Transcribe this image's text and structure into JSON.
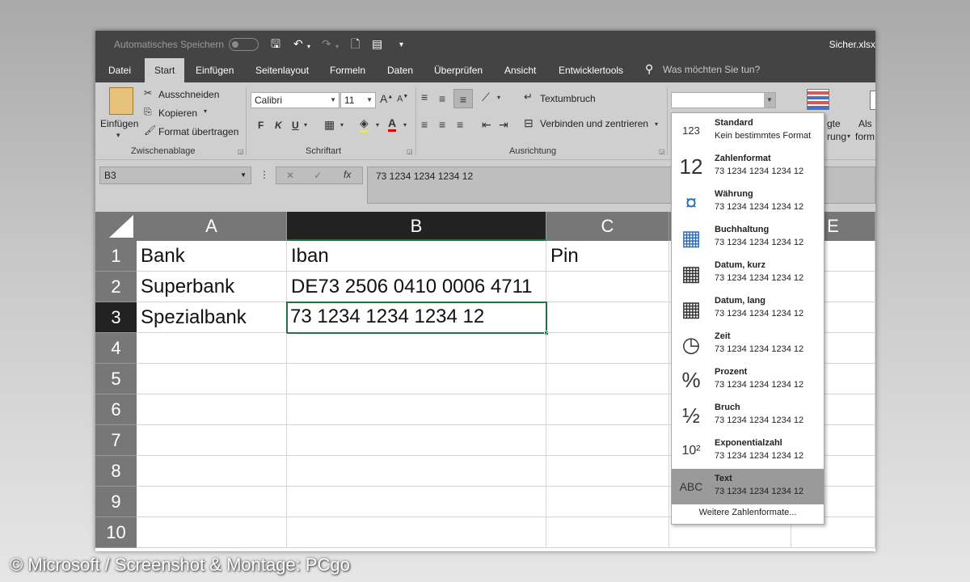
{
  "titlebar": {
    "autosave_label": "Automatisches Speichern",
    "filename": "Sicher.xlsx"
  },
  "tabs": [
    {
      "label": "Datei"
    },
    {
      "label": "Start"
    },
    {
      "label": "Einfügen"
    },
    {
      "label": "Seitenlayout"
    },
    {
      "label": "Formeln"
    },
    {
      "label": "Daten"
    },
    {
      "label": "Überprüfen"
    },
    {
      "label": "Ansicht"
    },
    {
      "label": "Entwicklertools"
    }
  ],
  "tell_me": "Was möchten Sie tun?",
  "ribbon": {
    "clipboard": {
      "paste": "Einfügen",
      "cut": "Ausschneiden",
      "copy": "Kopieren",
      "format_painter": "Format übertragen",
      "group_label": "Zwischenablage"
    },
    "font": {
      "font_name": "Calibri",
      "font_size": "11",
      "bold": "F",
      "italic": "K",
      "underline": "U",
      "group_label": "Schriftart"
    },
    "alignment": {
      "wrap_text": "Textumbruch",
      "merge_center": "Verbinden und zentrieren",
      "group_label": "Ausrichtung"
    },
    "styles": {
      "conditional_partial": "gte",
      "conditional_partial2": "rung",
      "as_table_partial": "Als",
      "as_table_partial2": "form"
    }
  },
  "formula_bar": {
    "name_box": "B3",
    "formula": "73 1234 1234 1234 12"
  },
  "sheet": {
    "columns": [
      "A",
      "B",
      "C",
      "D",
      "E"
    ],
    "rows": [
      "1",
      "2",
      "3",
      "4",
      "5",
      "6",
      "7",
      "8",
      "9",
      "10"
    ],
    "cells": {
      "A1": "Bank",
      "B1": "Iban",
      "C1": "Pin",
      "A2": "Superbank",
      "B2": "DE73 2506 0410 0006 4711",
      "A3": "Spezialbank",
      "B3": "73 1234 1234 1234 12"
    }
  },
  "number_format_dropdown": {
    "items": [
      {
        "name": "Standard",
        "sample": "Kein bestimmtes Format",
        "icon": "clock-123-icon"
      },
      {
        "name": "Zahlenformat",
        "sample": "73 1234 1234 1234 12",
        "icon": "12-number-icon"
      },
      {
        "name": "Währung",
        "sample": "73 1234 1234 1234 12",
        "icon": "currency-icon"
      },
      {
        "name": "Buchhaltung",
        "sample": "73 1234 1234 1234 12",
        "icon": "calculator-icon"
      },
      {
        "name": "Datum, kurz",
        "sample": "73 1234 1234 1234 12",
        "icon": "calendar-icon"
      },
      {
        "name": "Datum, lang",
        "sample": "73 1234 1234 1234 12",
        "icon": "calendar-icon"
      },
      {
        "name": "Zeit",
        "sample": "73 1234 1234 1234 12",
        "icon": "clock-icon"
      },
      {
        "name": "Prozent",
        "sample": "73 1234 1234 1234 12",
        "icon": "percent-icon"
      },
      {
        "name": "Bruch",
        "sample": "73 1234 1234 1234 12",
        "icon": "fraction-icon"
      },
      {
        "name": "Exponentialzahl",
        "sample": "73 1234 1234 1234 12",
        "icon": "exponent-icon"
      },
      {
        "name": "Text",
        "sample": "73 1234 1234 1234 12",
        "icon": "abc-text-icon"
      }
    ],
    "icon_glyphs": [
      "123",
      "12",
      "¤",
      "▦",
      "▦",
      "▦",
      "◷",
      "%",
      "½",
      "10²",
      "ABC"
    ],
    "selected_index": 10,
    "more_formats": "Weitere Zahlenformate..."
  },
  "watermark": "© Microsoft / Screenshot & Montage: PCgo",
  "colors": {
    "accent_green": "#217346",
    "titlebar": "#444444",
    "ribbon": "#cfcfcf"
  }
}
